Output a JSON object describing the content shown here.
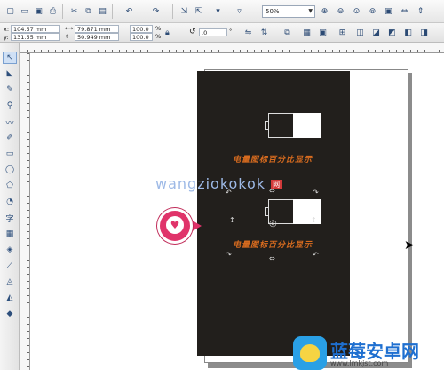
{
  "toolbar": {
    "zoom_value": "50%",
    "icons": [
      "new-icon",
      "open-icon",
      "save-icon",
      "print-icon",
      "cut-icon",
      "copy-icon",
      "paste-icon",
      "undo-icon",
      "redo-icon",
      "import-icon",
      "export-icon",
      "launcher-icon",
      "zoom-in-icon",
      "zoom-out-icon",
      "zoom-selected-icon",
      "zoom-all-icon",
      "zoom-page-icon",
      "zoom-width-icon",
      "zoom-height-icon"
    ]
  },
  "property_bar": {
    "x_label": "x:",
    "x_value": "104.57 mm",
    "y_label": "y:",
    "y_value": "131.55 mm",
    "w_value": "79.871 mm",
    "h_value": "50.949 mm",
    "scale_w": "100.0",
    "scale_h": "100.0",
    "percent": "%",
    "rotation": ".0",
    "degree": "°"
  },
  "toolbox": {
    "tools": [
      "pick-tool",
      "shape-tool",
      "crop-tool",
      "zoom-tool",
      "freehand-tool",
      "smart-drawing-tool",
      "rectangle-tool",
      "ellipse-tool",
      "polygon-tool",
      "basic-shapes-tool",
      "text-tool",
      "table-tool",
      "blend-tool",
      "eyedropper-tool",
      "outline-tool",
      "fill-tool",
      "interactive-fill-tool"
    ],
    "text_tool_label": "字"
  },
  "canvas": {
    "caption_top": "电量图标百分比显示",
    "caption_bottom": "电量图标百分比显示",
    "watermark": "wangziokokok",
    "watermark_badge": "网"
  },
  "brand": {
    "title": "蓝莓安卓网",
    "url": "www.lmkjst.com"
  }
}
